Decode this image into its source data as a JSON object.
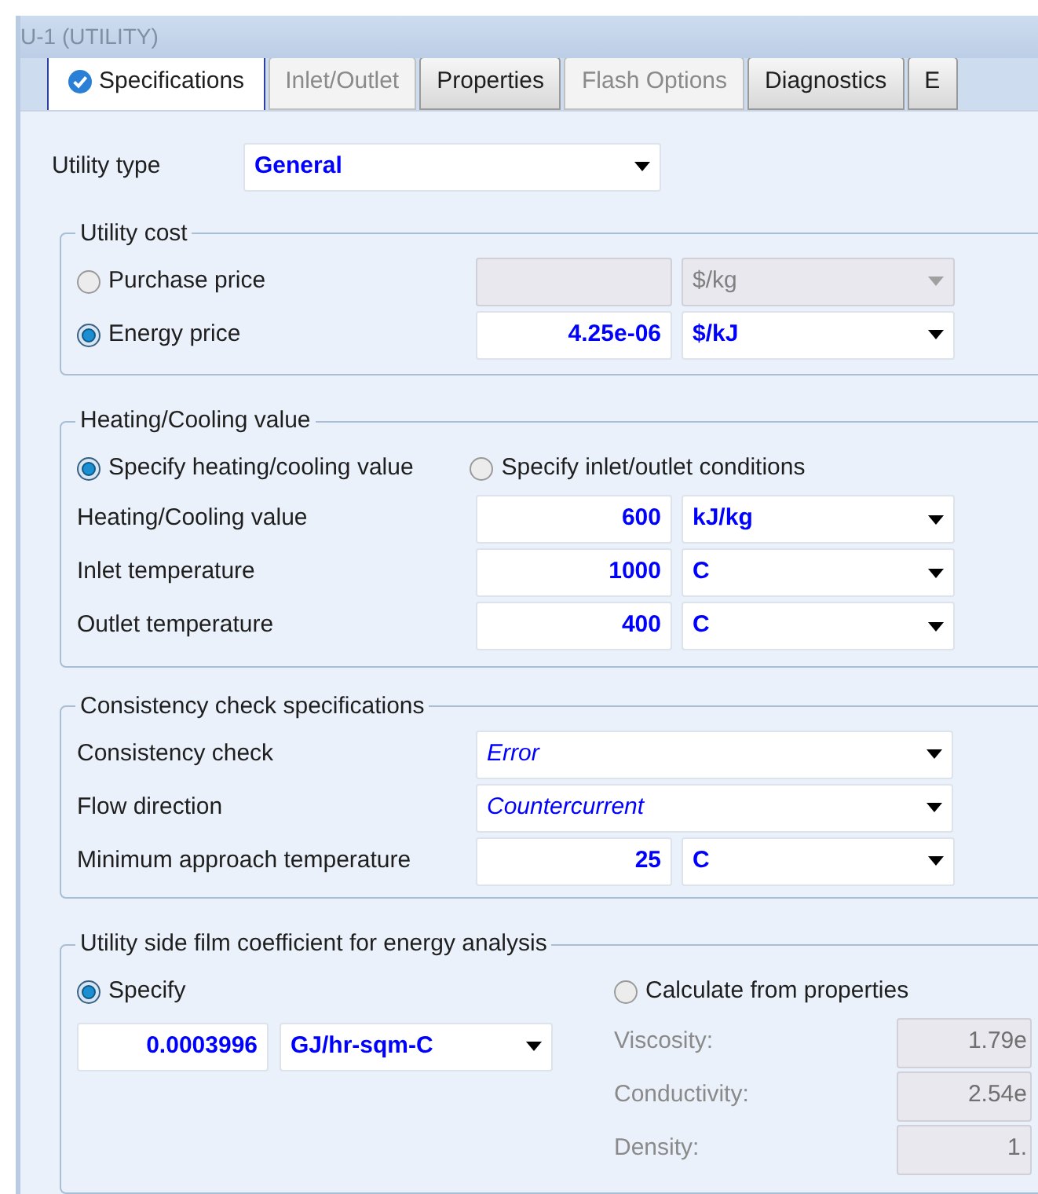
{
  "window": {
    "title": "U-1 (UTILITY)"
  },
  "tabs": [
    {
      "label": "Specifications",
      "selected": true,
      "disabled": false,
      "complete": true
    },
    {
      "label": "Inlet/Outlet",
      "selected": false,
      "disabled": true,
      "complete": false
    },
    {
      "label": "Properties",
      "selected": false,
      "disabled": false,
      "complete": false
    },
    {
      "label": "Flash Options",
      "selected": false,
      "disabled": true,
      "complete": false
    },
    {
      "label": "Diagnostics",
      "selected": false,
      "disabled": false,
      "complete": false
    },
    {
      "label": "E",
      "selected": false,
      "disabled": false,
      "complete": false
    }
  ],
  "utility_type": {
    "label": "Utility type",
    "value": "General"
  },
  "utility_cost": {
    "title": "Utility cost",
    "rows": [
      {
        "label": "Purchase price",
        "selected": false,
        "value": "",
        "unit": "$/kg",
        "disabled": true
      },
      {
        "label": "Energy price",
        "selected": true,
        "value": "4.25e-06",
        "unit": "$/kJ",
        "disabled": false
      }
    ]
  },
  "heating_cooling": {
    "title": "Heating/Cooling value",
    "options": [
      {
        "label": "Specify heating/cooling value",
        "selected": true
      },
      {
        "label": "Specify inlet/outlet conditions",
        "selected": false
      }
    ],
    "rows": [
      {
        "label": "Heating/Cooling value",
        "value": "600",
        "unit": "kJ/kg"
      },
      {
        "label": "Inlet temperature",
        "value": "1000",
        "unit": "C"
      },
      {
        "label": "Outlet temperature",
        "value": "400",
        "unit": "C"
      }
    ]
  },
  "consistency": {
    "title": "Consistency check specifications",
    "rows": [
      {
        "kind": "choice",
        "label": "Consistency check",
        "value": "Error"
      },
      {
        "kind": "choice",
        "label": "Flow direction",
        "value": "Countercurrent"
      },
      {
        "kind": "quantity",
        "label": "Minimum approach temperature",
        "value": "25",
        "unit": "C"
      }
    ]
  },
  "film_coefficient": {
    "title": "Utility side film coefficient for energy analysis",
    "specify": {
      "label": "Specify",
      "selected": true,
      "value": "0.0003996",
      "unit": "GJ/hr-sqm-C"
    },
    "calculate": {
      "label": "Calculate from properties",
      "selected": false
    },
    "properties": [
      {
        "label": "Viscosity:",
        "value": "1.79e",
        "disabled": true
      },
      {
        "label": "Conductivity:",
        "value": "2.54e",
        "disabled": true
      },
      {
        "label": "Density:",
        "value": "1.",
        "disabled": true
      }
    ]
  }
}
